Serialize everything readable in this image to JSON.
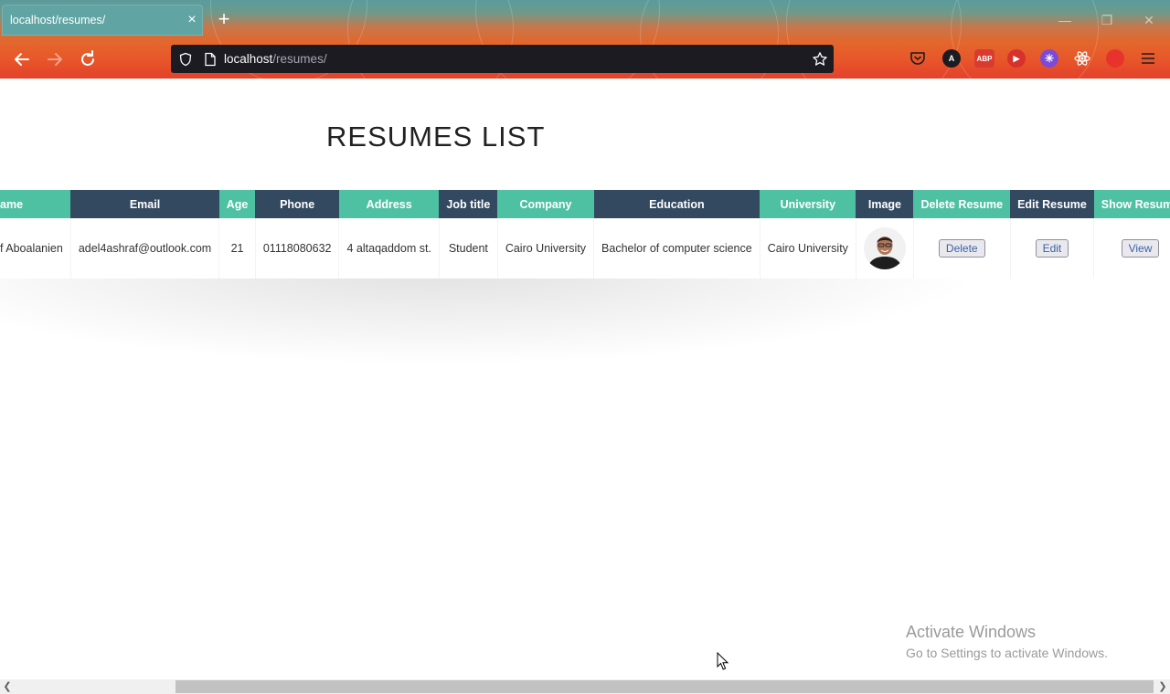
{
  "browser": {
    "tab_title": "localhost/resumes/",
    "tab_close": "×",
    "new_tab": "+",
    "url_host": "localhost",
    "url_path": "/resumes/",
    "window_controls": [
      "minimize",
      "restore",
      "close"
    ],
    "extensions": [
      "pocket-icon",
      "account-icon",
      "abp-icon",
      "ublock-icon",
      "snowflake-icon",
      "react-devtools-icon",
      "heart-icon"
    ],
    "abp_label": "ABP",
    "account_letter": "A"
  },
  "page": {
    "title": "RESUMES LIST"
  },
  "table": {
    "headers": [
      "ame",
      "Email",
      "Age",
      "Phone",
      "Address",
      "Job title",
      "Company",
      "Education",
      "University",
      "Image",
      "Delete Resume",
      "Edit Resume",
      "Show Resume"
    ],
    "header_colors": [
      "#4fc1a3",
      "#324960"
    ],
    "rows": [
      {
        "name": "f Aboalanien",
        "email": "adel4ashraf@outlook.com",
        "age": "21",
        "phone": "01118080632",
        "address": "4 altaqaddom st.",
        "job_title": "Student",
        "company": "Cairo University",
        "education": "Bachelor of computer science",
        "university": "Cairo University",
        "image": "profile-photo",
        "delete_label": "Delete",
        "edit_label": "Edit",
        "view_label": "View"
      }
    ]
  },
  "watermark": {
    "line1": "Activate Windows",
    "line2": "Go to Settings to activate Windows."
  }
}
